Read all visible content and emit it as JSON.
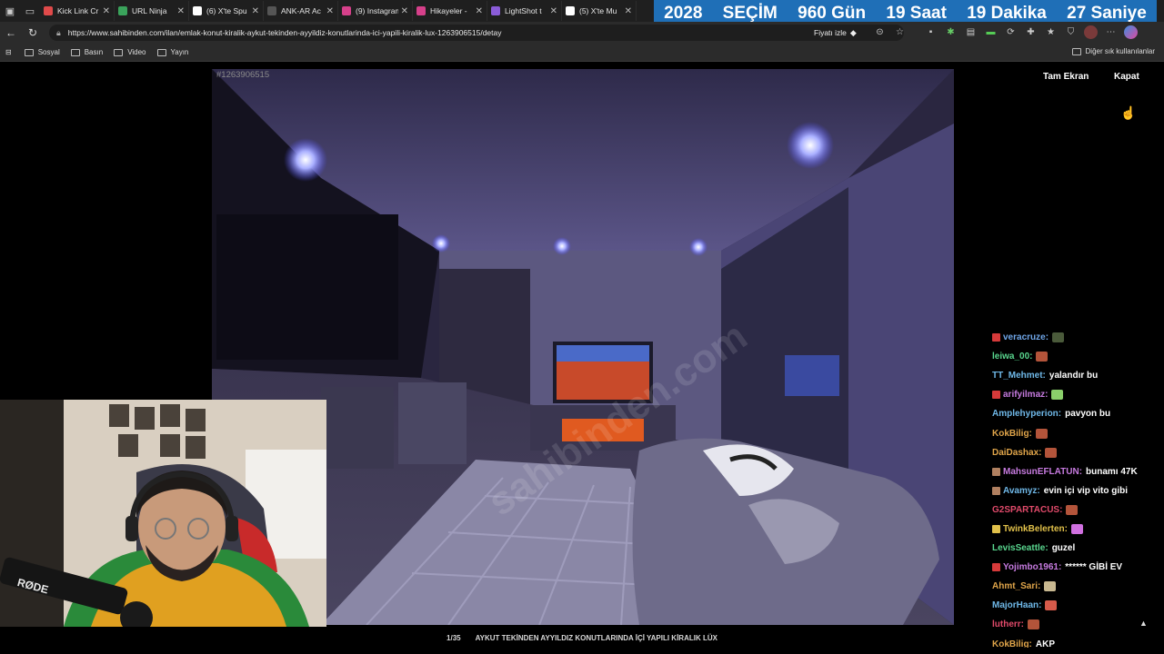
{
  "tabs": [
    {
      "title": "Kick Link Cr",
      "color": "#e04a4a"
    },
    {
      "title": "URL Ninja",
      "color": "#3aa35b"
    },
    {
      "title": "(6) X'te Spu",
      "color": "#ffffff"
    },
    {
      "title": "ANK-AR Ac",
      "color": "#555555"
    },
    {
      "title": "(9) Instagram",
      "color": "#d6408a"
    },
    {
      "title": "Hikayeler -",
      "color": "#d6408a"
    },
    {
      "title": "LightShot t",
      "color": "#8a5cd8"
    },
    {
      "title": "(5) X'te Mu",
      "color": "#ffffff"
    }
  ],
  "countdown": {
    "year": "2028",
    "label": "SEÇİM",
    "days": "960 Gün",
    "hours": "19 Saat",
    "minutes": "19 Dakika",
    "seconds": "27 Saniye"
  },
  "address_bar": {
    "url": "https://www.sahibinden.com/ilan/emlak-konut-kiralik-aykut-tekinden-ayyildiz-konutlarinda-ici-yapili-kiralik-lux-1263906515/detay",
    "price_watch": "Fiyatı izle"
  },
  "bookmarks": {
    "items": [
      "Sosyal",
      "Basın",
      "Video",
      "Yayın"
    ],
    "other": "Diğer sık kullanılanlar"
  },
  "viewer": {
    "listing_id": "#1263906515",
    "fullscreen_label": "Tam Ekran",
    "close_label": "Kapat",
    "counter": "1/35",
    "caption": "AYKUT TEKİNDEN AYYILDIZ KONUTLARINDA İÇİ YAPILI KİRALIK LÜX",
    "watermark": "sahibinden.com"
  },
  "webcam": {
    "mic_brand": "RØDE"
  },
  "chat": [
    {
      "user": "veracruze:",
      "color": "#6fa6e8",
      "badge": "#d63a3a",
      "text": "",
      "emote": "#4a5a3a"
    },
    {
      "user": "leiwa_00:",
      "color": "#59d68e",
      "badge": "",
      "text": "",
      "emote": "#b3543a"
    },
    {
      "user": "TT_Mehmet:",
      "color": "#6fb8e8",
      "badge": "",
      "text": "yalandır bu",
      "emote": ""
    },
    {
      "user": "arifyilmaz:",
      "color": "#c77be0",
      "badge": "#d63a3a",
      "text": "",
      "emote": "#8bd06b"
    },
    {
      "user": "Amplehyperion:",
      "color": "#6fb8e8",
      "badge": "",
      "text": "pavyon bu",
      "emote": ""
    },
    {
      "user": "KokBilig:",
      "color": "#e0a54a",
      "badge": "",
      "text": "",
      "emote": "#b3543a"
    },
    {
      "user": "DaiDashax:",
      "color": "#e0a54a",
      "badge": "",
      "text": "",
      "emote": "#b3543a"
    },
    {
      "user": "MahsunEFLATUN:",
      "color": "#c77be0",
      "badge": "#b08060",
      "text": "bunamı 47K",
      "emote": ""
    },
    {
      "user": "Avamyz:",
      "color": "#6fb8e8",
      "badge": "#b08060",
      "text": "evin içi vip vito gibi",
      "emote": ""
    },
    {
      "user": "G2SPARTACUS:",
      "color": "#e04a6a",
      "badge": "",
      "text": "",
      "emote": "#b3543a"
    },
    {
      "user": "TwinkBelerten:",
      "color": "#e0c04a",
      "badge": "#e0c04a",
      "text": "",
      "emote": "#d070e0"
    },
    {
      "user": "LevisSeattle:",
      "color": "#59d68e",
      "badge": "",
      "text": "guzel",
      "emote": ""
    },
    {
      "user": "Yojimbo1961:",
      "color": "#c77be0",
      "badge": "#d63a3a",
      "text": "****** GİBİ EV",
      "emote": ""
    },
    {
      "user": "Ahmt_Sari:",
      "color": "#e0a54a",
      "badge": "",
      "text": "",
      "emote": "#c8b890"
    },
    {
      "user": "MajorHaan:",
      "color": "#6fb8e8",
      "badge": "",
      "text": "",
      "emote": "#d65a4a"
    },
    {
      "user": "lutherr:",
      "color": "#e04a6a",
      "badge": "",
      "text": "",
      "emote": "#b3543a"
    },
    {
      "user": "KokBilig:",
      "color": "#e0a54a",
      "badge": "",
      "text": "AKP",
      "emote": ""
    }
  ]
}
